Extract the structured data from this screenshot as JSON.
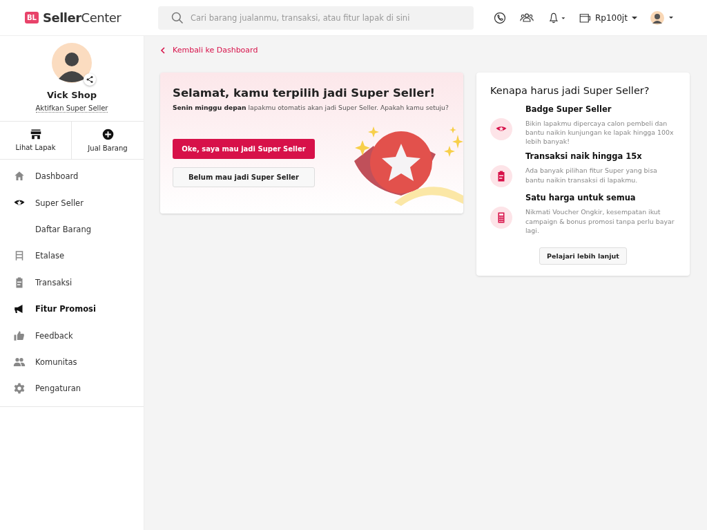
{
  "header": {
    "logo_badge": "BL",
    "logo_text_bold": "Seller",
    "logo_text": "Center",
    "search": {
      "placeholder": "Cari barang jualanmu, transaksi, atau fitur lapak di sini"
    },
    "balance": "Rp100jt"
  },
  "sidebar": {
    "shop_name": "Vick Shop",
    "activate_link": "Aktifkan Super Seller",
    "shortcuts": [
      {
        "label": "Lihat Lapak"
      },
      {
        "label": "Jual Barang"
      }
    ],
    "items": [
      {
        "label": "Dashboard",
        "kind": "item",
        "selected": false
      },
      {
        "label": "Super Seller",
        "kind": "item",
        "selected": false
      },
      {
        "label": "Daftar Barang",
        "kind": "subitem",
        "selected": false
      },
      {
        "label": "Etalase",
        "kind": "item",
        "selected": false
      },
      {
        "label": "Transaksi",
        "kind": "item",
        "selected": false
      },
      {
        "label": "Fitur Promosi",
        "kind": "item",
        "selected": true
      },
      {
        "label": "Feedback",
        "kind": "item",
        "selected": false
      },
      {
        "label": "Komunitas",
        "kind": "item",
        "selected": false
      },
      {
        "label": "Pengaturan",
        "kind": "item",
        "selected": false
      }
    ]
  },
  "back_link": "Kembali ke Dashboard",
  "offer": {
    "title": "Selamat, kamu terpilih jadi Super Seller!",
    "text": "**Senin minggu depan** lapakmu otomatis akan jadi Super Seller. Apakah kamu setuju?",
    "accept_button": "Oke, saya mau jadi Super Seller",
    "decline_button": "Belum mau jadi Super Seller"
  },
  "benefits": {
    "title": "Kenapa harus jadi Super Seller?",
    "items": [
      {
        "title": "Badge Super Seller",
        "text": "Bikin lapakmu dipercaya calon pembeli dan bantu naikin kunjungan ke lapak hingga 100x lebih banyak!"
      },
      {
        "title": "Transaksi naik hingga 15x",
        "text": "Ada banyak pilihan fitur Super yang bisa bantu naikin transaksi di lapakmu."
      },
      {
        "title": "Satu harga untuk semua",
        "text": "Nikmati Voucher Ongkir, kesempatan ikut campaign & bonus promosi tanpa perlu bayar lagi."
      }
    ],
    "button": "Pelajari lebih lanjut"
  }
}
